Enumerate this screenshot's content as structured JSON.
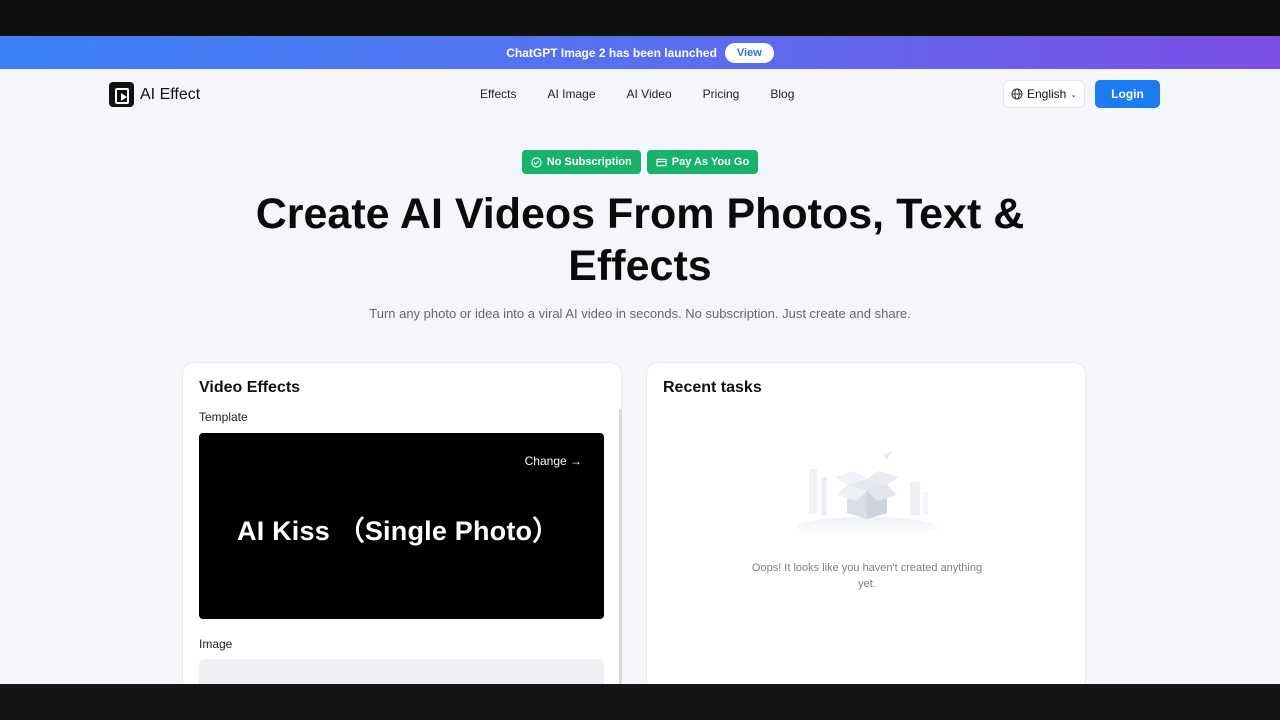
{
  "announcement": {
    "text": "ChatGPT Image 2 has been launched",
    "button_label": "View"
  },
  "header": {
    "logo_text": "AI Effect",
    "nav": [
      {
        "label": "Effects"
      },
      {
        "label": "AI Image"
      },
      {
        "label": "AI Video"
      },
      {
        "label": "Pricing"
      },
      {
        "label": "Blog"
      }
    ],
    "language": "English",
    "login_label": "Login"
  },
  "badges": [
    {
      "label": "No Subscription",
      "icon": "check-circle-icon"
    },
    {
      "label": "Pay As You Go",
      "icon": "credit-card-icon"
    }
  ],
  "hero": {
    "title": "Create AI Videos From Photos, Text & Effects",
    "subtitle": "Turn any photo or idea into a viral AI video in seconds. No subscription. Just create and share."
  },
  "video_effects": {
    "title": "Video Effects",
    "template_label": "Template",
    "change_label": "Change →",
    "template_name": "AI Kiss （Single Photo）",
    "image_label": "Image"
  },
  "recent_tasks": {
    "title": "Recent tasks",
    "empty_message": "Oops! It looks like you haven't created anything yet."
  },
  "colors": {
    "accent_blue": "#1a7cf0",
    "badge_green": "#18b26b",
    "banner_gradient_start": "#3b82f6",
    "banner_gradient_end": "#7c4ee8"
  }
}
